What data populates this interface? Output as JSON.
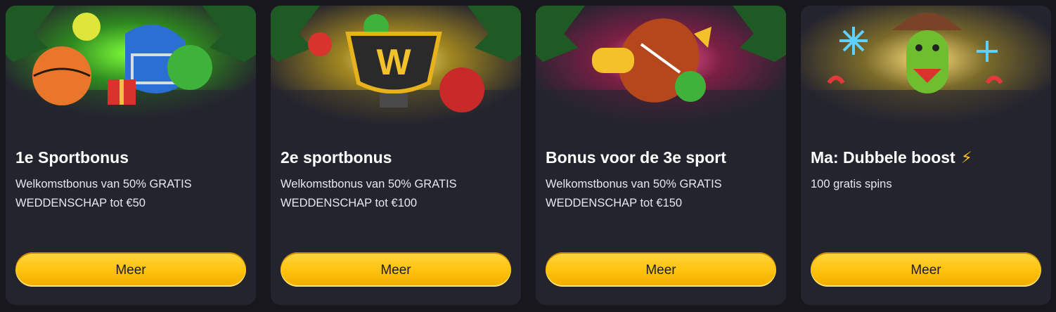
{
  "cards": [
    {
      "title": "1e Sportbonus",
      "line1": "Welkomstbonus van 50% GRATIS",
      "line2": "WEDDENSCHAP tot €50",
      "button_label": "Meer",
      "accent": "#5cd61e"
    },
    {
      "title": "2e sportbonus",
      "line1": "Welkomstbonus van 50% GRATIS",
      "line2": "WEDDENSCHAP tot €100",
      "button_label": "Meer",
      "accent": "#f3c12a"
    },
    {
      "title": "Bonus voor de 3e sport",
      "line1": "Welkomstbonus van 50% GRATIS",
      "line2": "WEDDENSCHAP tot €150",
      "button_label": "Meer",
      "accent": "#e0306e"
    },
    {
      "title": "Ma: Dubbele boost",
      "title_icon": "⚡",
      "line1": "100 gratis spins",
      "line2": "",
      "button_label": "Meer",
      "accent": "#f3c12a"
    }
  ],
  "colors": {
    "button": "#fdc20b",
    "card_bg": "#24242e",
    "page_bg": "#17171d"
  }
}
